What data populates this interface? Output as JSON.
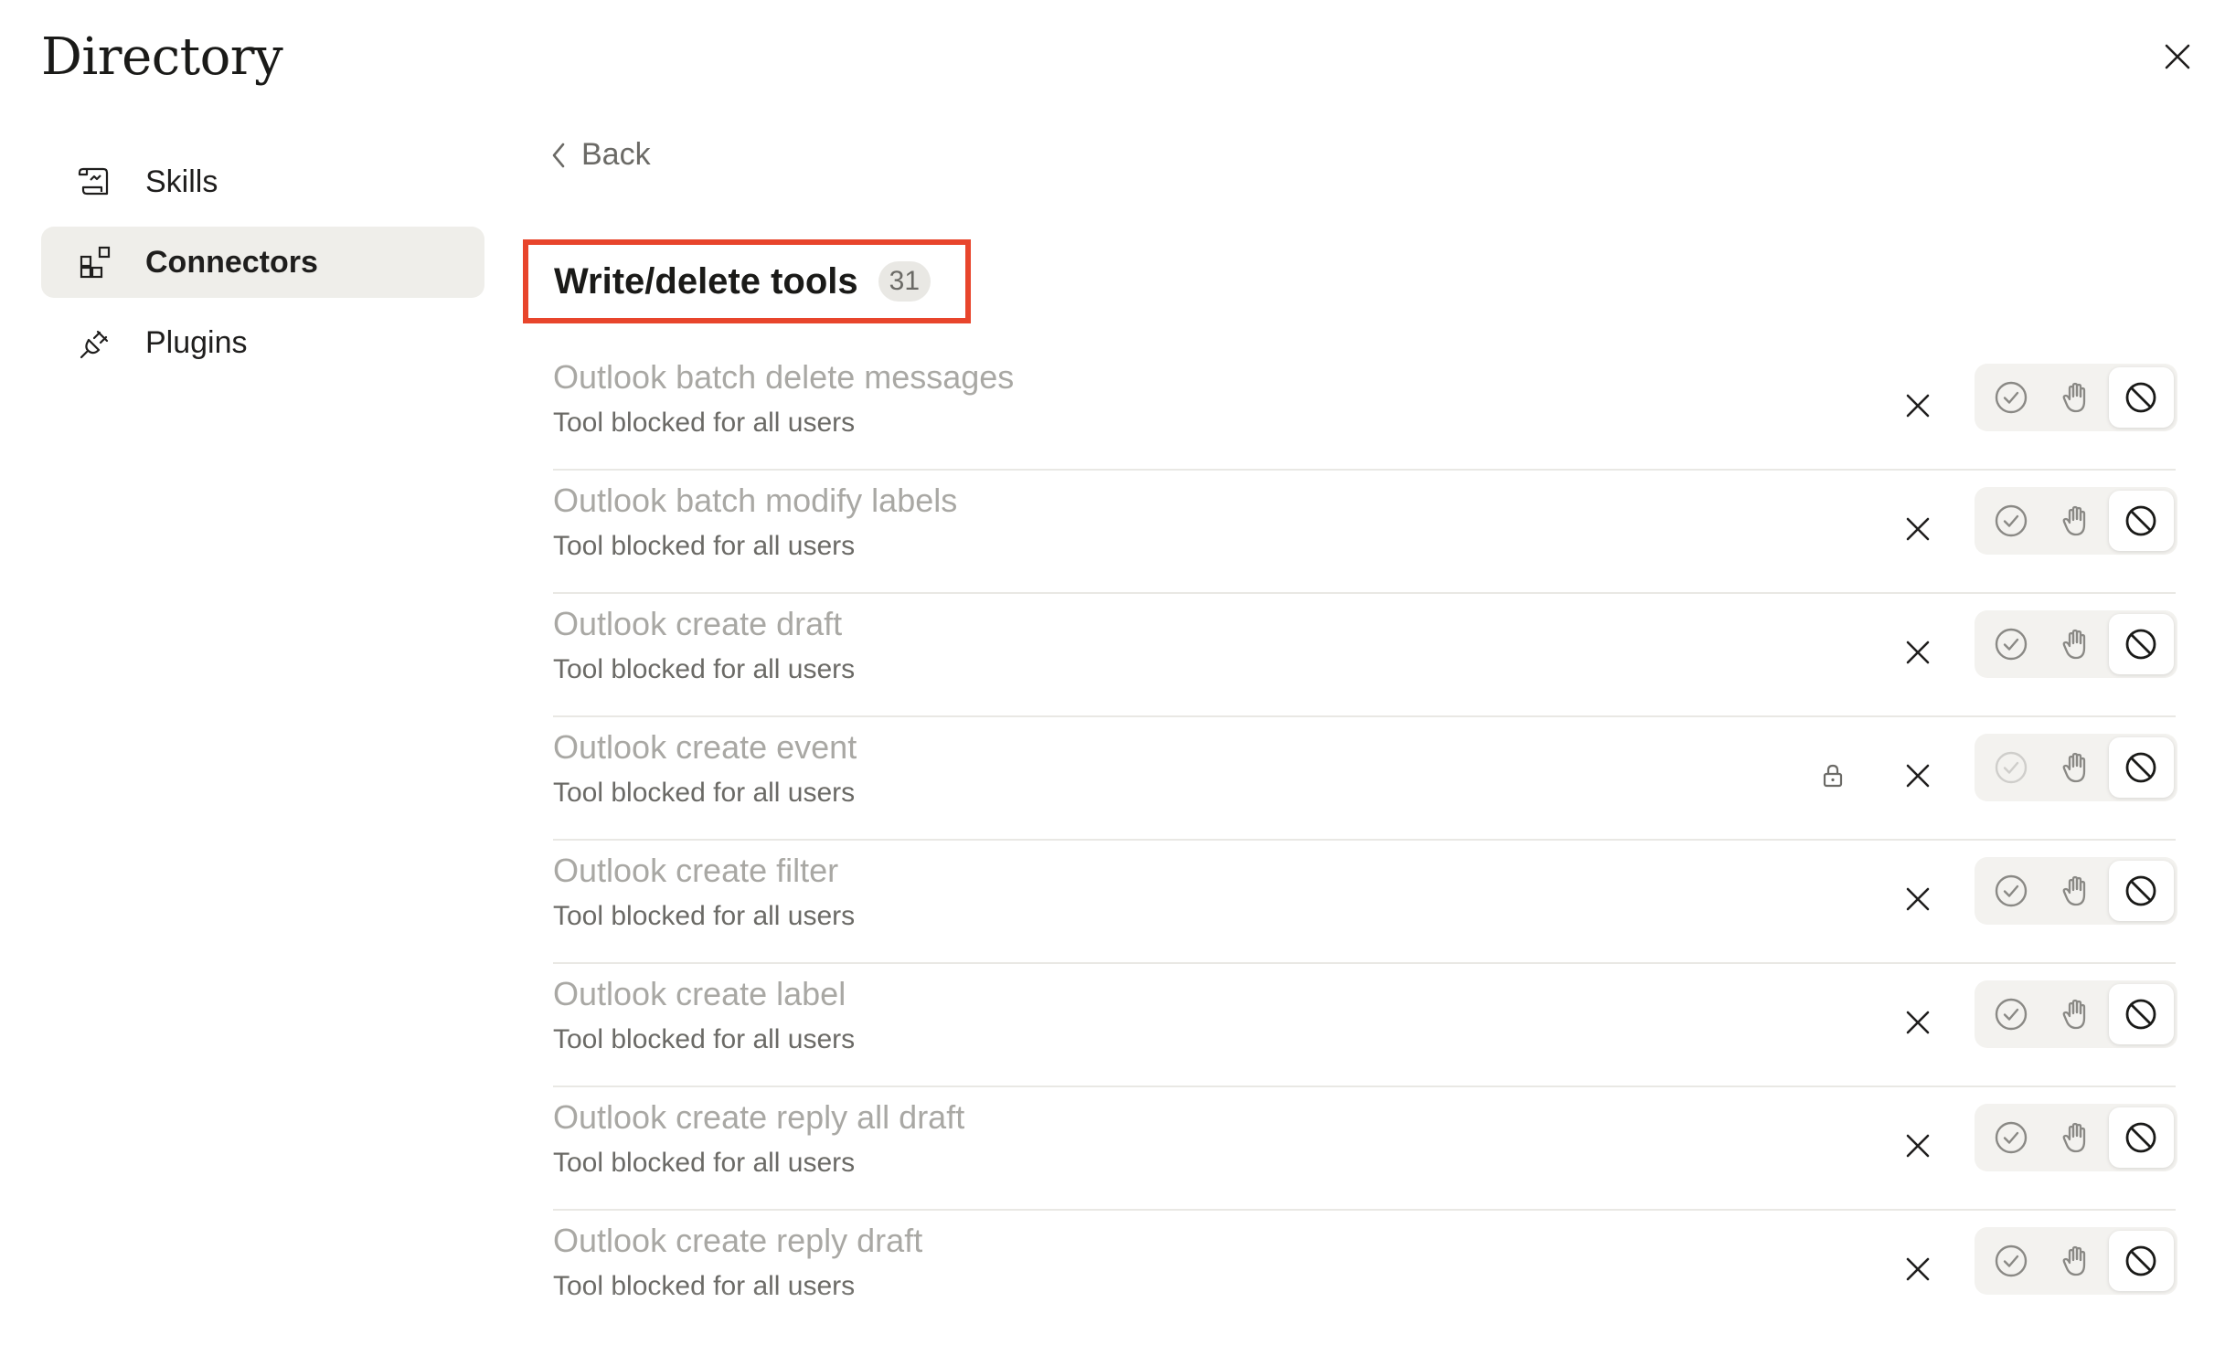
{
  "header": {
    "title": "Directory",
    "close_icon": "close-icon"
  },
  "sidebar": {
    "items": [
      {
        "label": "Skills",
        "icon": "scroll-icon",
        "active": false
      },
      {
        "label": "Connectors",
        "icon": "blocks-icon",
        "active": true
      },
      {
        "label": "Plugins",
        "icon": "plug-icon",
        "active": false
      }
    ]
  },
  "main": {
    "back_label": "Back",
    "section": {
      "title": "Write/delete tools",
      "count": "31"
    },
    "tools": [
      {
        "name": "Outlook batch delete messages",
        "status": "Tool blocked for all users",
        "locked": false
      },
      {
        "name": "Outlook batch modify labels",
        "status": "Tool blocked for all users",
        "locked": false
      },
      {
        "name": "Outlook create draft",
        "status": "Tool blocked for all users",
        "locked": false
      },
      {
        "name": "Outlook create event",
        "status": "Tool blocked for all users",
        "locked": true
      },
      {
        "name": "Outlook create filter",
        "status": "Tool blocked for all users",
        "locked": false
      },
      {
        "name": "Outlook create label",
        "status": "Tool blocked for all users",
        "locked": false
      },
      {
        "name": "Outlook create reply all draft",
        "status": "Tool blocked for all users",
        "locked": false
      },
      {
        "name": "Outlook create reply draft",
        "status": "Tool blocked for all users",
        "locked": false
      }
    ],
    "permission_options": [
      "check-circle-icon",
      "hand-icon",
      "blocked-icon"
    ],
    "selected_permission": "blocked-icon"
  },
  "colors": {
    "highlight_border": "#e8452c",
    "active_nav_bg": "#efeeea",
    "muted_text": "#a9a8a4"
  }
}
